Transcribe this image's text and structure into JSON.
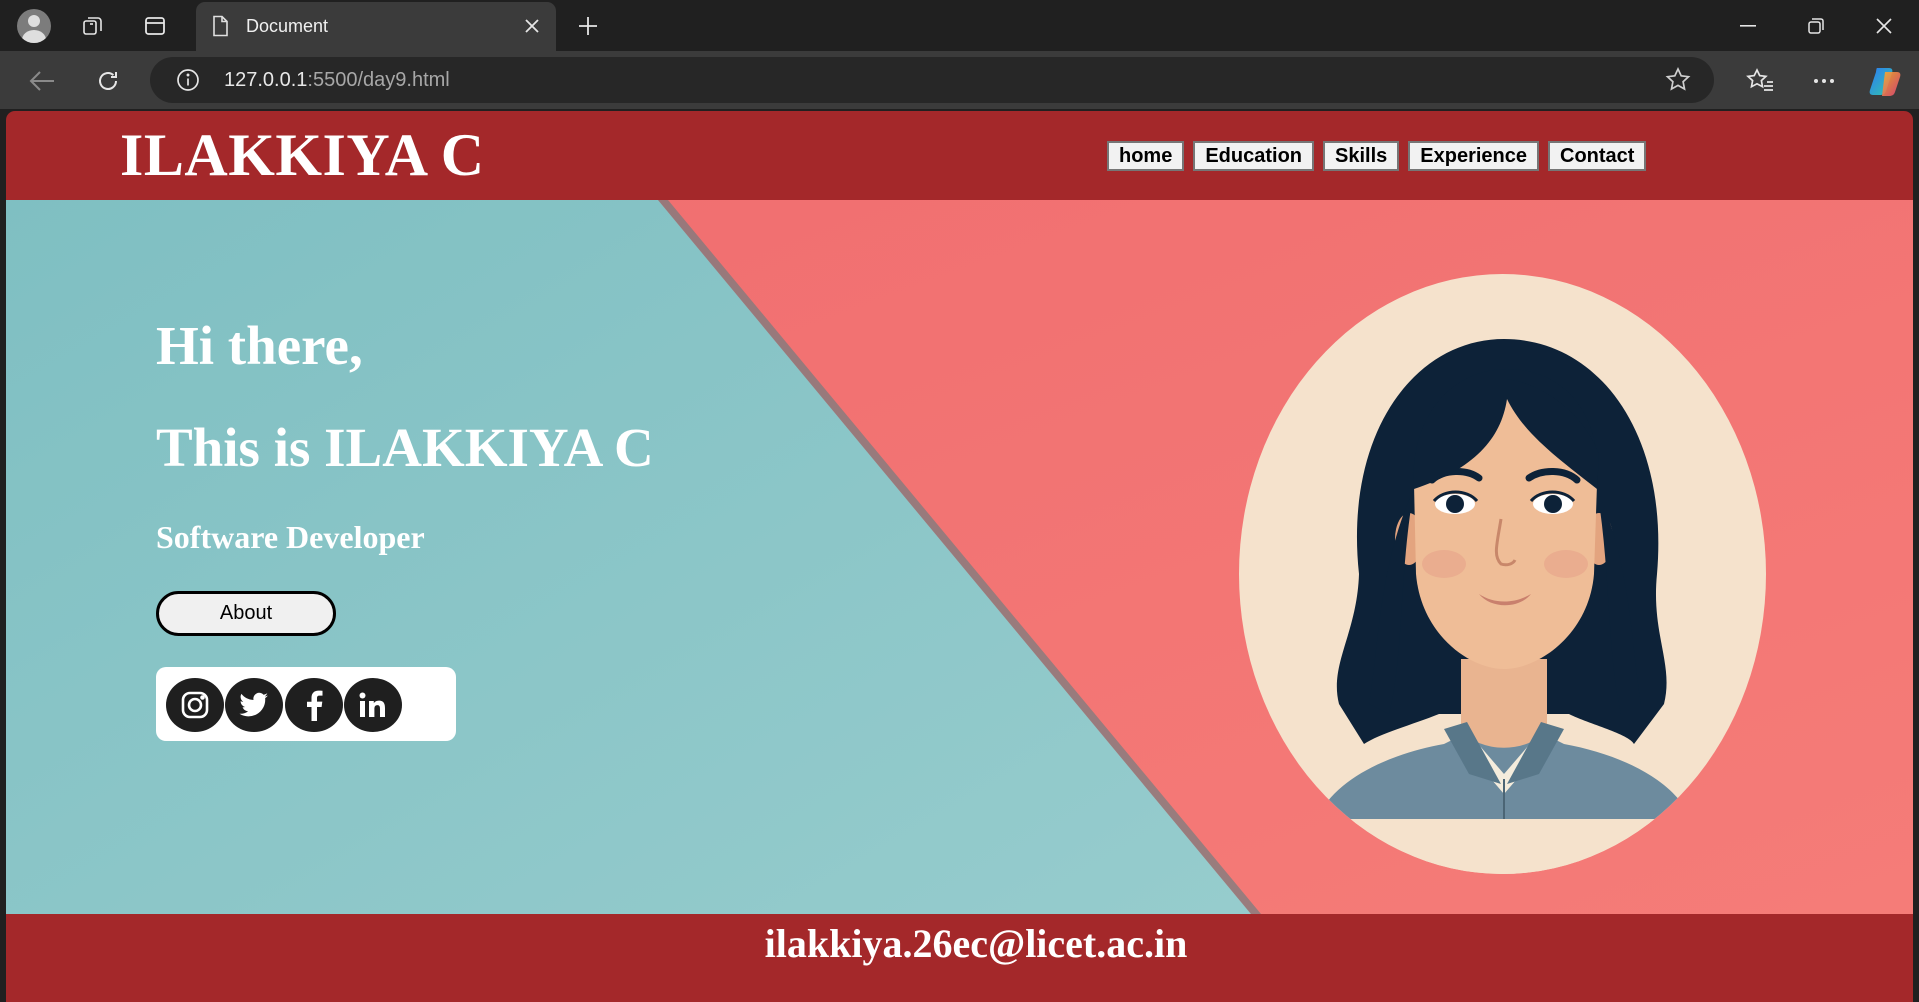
{
  "browser": {
    "tab_title": "Document",
    "url_host": "127.0.0.1",
    "url_rest": ":5500/day9.html",
    "icons": [
      "profile-avatar",
      "workspaces-icon",
      "vertical-tabs-icon",
      "document-icon",
      "close-icon",
      "plus-icon",
      "minimize-icon",
      "restore-icon",
      "window-close-icon",
      "back-arrow-icon",
      "reload-icon",
      "info-icon",
      "star-icon",
      "favorites-icon",
      "more-icon",
      "copilot-icon"
    ]
  },
  "site": {
    "logo": "ILAKKIYA C",
    "nav": [
      "home",
      "Education",
      "Skills",
      "Experience",
      "Contact"
    ],
    "hero": {
      "greeting": "Hi there,",
      "intro": "This is ILAKKIYA C",
      "role": "Software Developer",
      "about_label": "About",
      "social_icons": [
        "instagram-icon",
        "twitter-icon",
        "facebook-icon",
        "linkedin-icon"
      ]
    },
    "footer_email": "ilakkiya.26ec@licet.ac.in"
  },
  "colors": {
    "header_bg": "#a4282a",
    "hero_teal": "#8cc8c9",
    "hero_coral": "#f37777",
    "portrait_bg": "#f5e2cc"
  }
}
